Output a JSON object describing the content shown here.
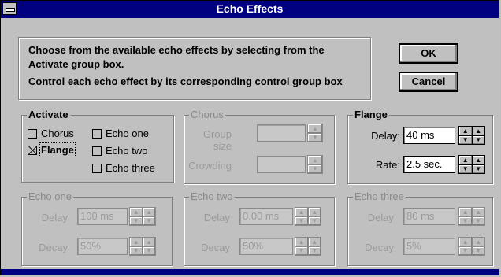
{
  "window": {
    "title": "Echo Effects"
  },
  "info": {
    "line1": "Choose from the available echo effects by selecting from the",
    "line2": "Activate group box.",
    "line3": "Control each echo effect by its corresponding control group box"
  },
  "buttons": {
    "ok": "OK",
    "cancel": "Cancel"
  },
  "activate": {
    "label": "Activate",
    "options": [
      {
        "label": "Chorus",
        "checked": false
      },
      {
        "label": "Flange",
        "checked": true
      },
      {
        "label": "Echo one",
        "checked": false
      },
      {
        "label": "Echo two",
        "checked": false
      },
      {
        "label": "Echo three",
        "checked": false
      }
    ]
  },
  "chorus": {
    "label": "Chorus",
    "group_size_label": "Group size",
    "crowding_label": "Crowding",
    "group_size_value": "",
    "crowding_value": ""
  },
  "flange": {
    "label": "Flange",
    "delay_label": "Delay:",
    "delay_value": "40 ms",
    "rate_label": "Rate:",
    "rate_value": "2.5 sec."
  },
  "echo_one": {
    "label": "Echo one",
    "delay_label": "Delay",
    "decay_label": "Decay",
    "delay_value": "100 ms",
    "decay_value": "50%"
  },
  "echo_two": {
    "label": "Echo two",
    "delay_label": "Delay",
    "decay_label": "Decay",
    "delay_value": "0.00 ms",
    "decay_value": "50%"
  },
  "echo_three": {
    "label": "Echo three",
    "delay_label": "Delay",
    "decay_label": "Decay",
    "delay_value": "80 ms",
    "decay_value": "5%"
  },
  "spin_glyphs": {
    "up": "▲",
    "down": "▼"
  }
}
